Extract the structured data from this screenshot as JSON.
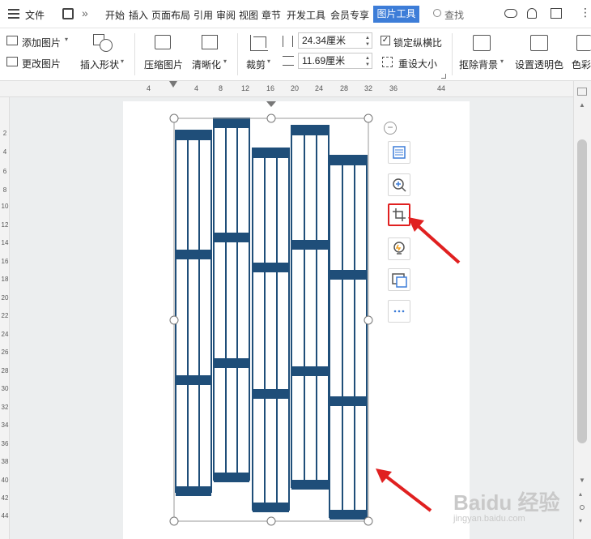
{
  "menu": {
    "file": "文件",
    "tabs": [
      "开始",
      "插入",
      "页面布局",
      "引用",
      "审阅",
      "视图",
      "章节",
      "开发工具",
      "会员专享"
    ],
    "active_tab": "图片工具",
    "search": "查找"
  },
  "ribbon": {
    "add_picture": "添加图片",
    "change_picture": "更改图片",
    "insert_shape": "插入形状",
    "compress": "压缩图片",
    "clarity": "清晰化",
    "crop": "裁剪",
    "width_value": "24.34厘米",
    "height_value": "11.69厘米",
    "lock_ratio": "锁定纵横比",
    "reset_size": "重设大小",
    "remove_bg": "抠除背景",
    "set_transparent": "设置透明色",
    "color": "色彩"
  },
  "ruler": {
    "h_ticks": [
      "4",
      "4",
      "8",
      "12",
      "16",
      "20",
      "24",
      "28",
      "32",
      "36",
      "44"
    ],
    "v_ticks": [
      "2",
      "4",
      "6",
      "8",
      "10",
      "12",
      "14",
      "16",
      "18",
      "20",
      "22",
      "24",
      "26",
      "28",
      "30",
      "32",
      "34",
      "36",
      "38",
      "40",
      "42",
      "44"
    ]
  },
  "watermark": {
    "text": "Baidu 经验",
    "url": "jingyan.baidu.com"
  },
  "colors": {
    "accent": "#3d7dd8",
    "block_blue": "#1f4e79",
    "highlight_red": "#e02020"
  }
}
